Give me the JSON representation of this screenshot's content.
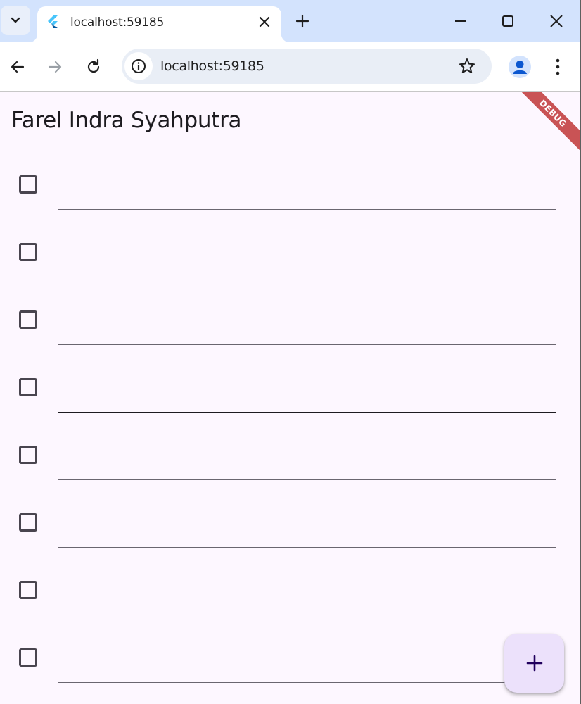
{
  "browser": {
    "tab": {
      "title": "localhost:59185",
      "favicon": "flutter-icon"
    },
    "address_bar": {
      "url": "localhost:59185"
    },
    "icons": {
      "tab_search": "chevron-down-icon",
      "close_tab": "close-icon",
      "new_tab": "plus-icon",
      "minimize": "minimize-icon",
      "maximize": "maximize-icon",
      "close_window": "close-icon",
      "back": "back-arrow-icon",
      "forward": "forward-arrow-icon",
      "reload": "reload-icon",
      "site_info": "info-icon",
      "bookmark": "star-icon",
      "profile": "avatar-icon",
      "menu": "kebab-menu-icon"
    }
  },
  "app": {
    "title": "Farel Indra Syahputra",
    "debug_banner": "DEBUG",
    "todos": [
      {
        "checked": false,
        "text": ""
      },
      {
        "checked": false,
        "text": ""
      },
      {
        "checked": false,
        "text": ""
      },
      {
        "checked": false,
        "text": ""
      },
      {
        "checked": false,
        "text": ""
      },
      {
        "checked": false,
        "text": ""
      },
      {
        "checked": false,
        "text": ""
      },
      {
        "checked": false,
        "text": ""
      }
    ],
    "fab_icon": "plus-icon",
    "colors": {
      "background": "#fdf7ff",
      "fab": "#ece1fb",
      "checkbox_border": "#49454f",
      "debug_banner": "#b71c1c"
    }
  }
}
